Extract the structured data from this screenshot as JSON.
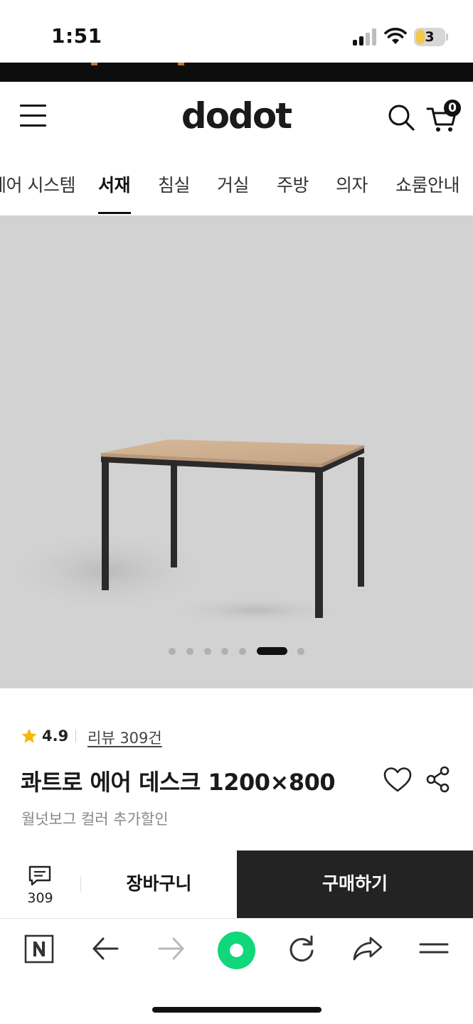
{
  "status_bar": {
    "time": "1:51",
    "battery_level": "3",
    "icons": [
      "signal-icon",
      "wifi-icon",
      "battery-icon"
    ]
  },
  "header": {
    "logo": "dodot",
    "cart_count": "0",
    "icons": [
      "menu-icon",
      "search-icon",
      "cart-icon"
    ]
  },
  "nav": {
    "items": [
      "에어 시스템",
      "서재",
      "침실",
      "거실",
      "주방",
      "의자",
      "쇼룸안내"
    ],
    "active": "서재"
  },
  "gallery": {
    "slide_count": 7,
    "active_slide": 6
  },
  "product": {
    "rating": "4.9",
    "review_link": "리뷰 309건",
    "title": "콰트로 에어 데스크 1200×800",
    "subtitle": "월넛보그 컬러 추가할인",
    "icons": [
      "star-icon",
      "heart-icon",
      "share-icon"
    ]
  },
  "purchase_bar": {
    "review_count": "309",
    "cart_label": "장바구니",
    "buy_label": "구매하기"
  },
  "browser_toolbar": {
    "icons": [
      "naver-n-icon",
      "back-arrow-icon",
      "forward-arrow-icon",
      "green-dot-icon",
      "reload-icon",
      "share-arrow-icon",
      "hamburger-icon"
    ]
  },
  "colors": {
    "accent_green": "#10d77a",
    "buy_button": "#232323",
    "star": "#f5b800",
    "image_background": "#d2d2d2"
  }
}
